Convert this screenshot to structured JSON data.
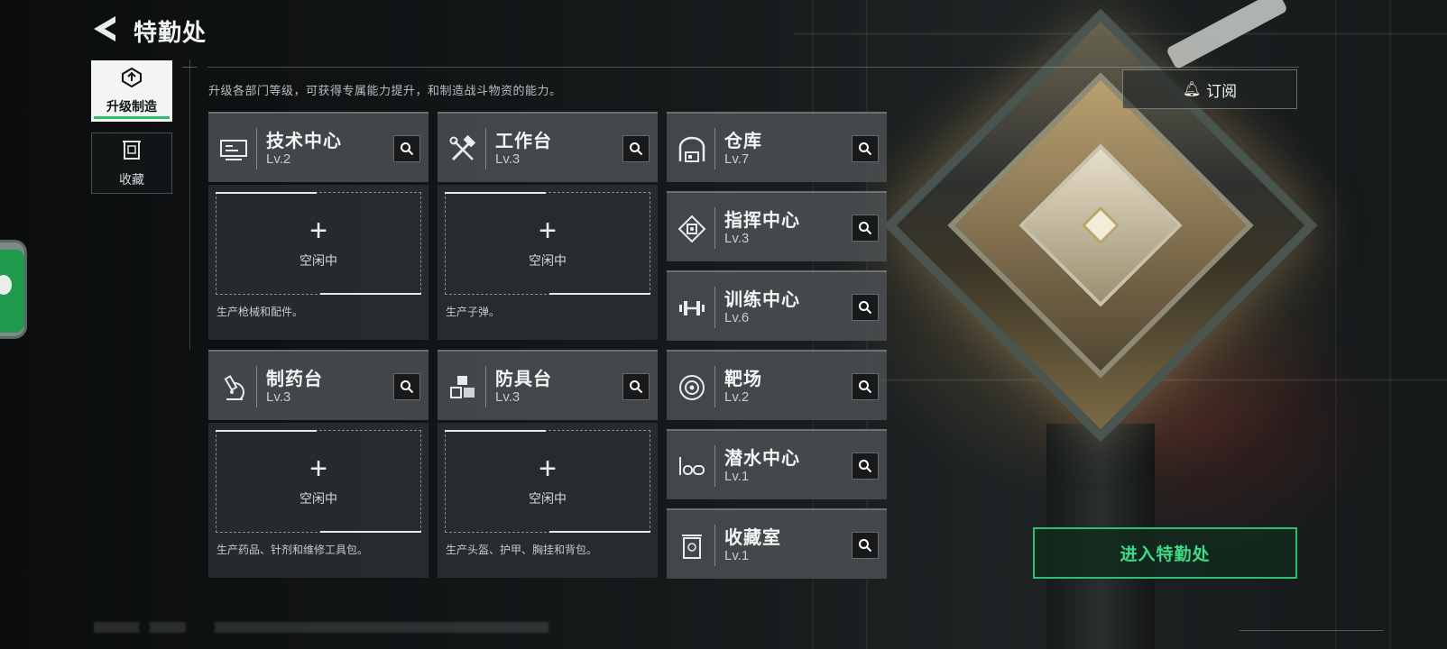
{
  "header": {
    "title": "特勤处"
  },
  "side_tabs": [
    {
      "label": "升级制造",
      "icon": "upgrade-icon",
      "active": true
    },
    {
      "label": "收藏",
      "icon": "collection-icon",
      "active": false
    }
  ],
  "description": "升级各部门等级，可获得专属能力提升，和制造战斗物资的能力。",
  "subscribe": {
    "label": "订阅",
    "icon": "bell-icon"
  },
  "departments": {
    "tech_center": {
      "name": "技术中心",
      "level": "Lv.2",
      "icon": "monitor-icon"
    },
    "workbench": {
      "name": "工作台",
      "level": "Lv.3",
      "icon": "tools-icon"
    },
    "pharmacy": {
      "name": "制药台",
      "level": "Lv.3",
      "icon": "microscope-icon"
    },
    "armor_bench": {
      "name": "防具台",
      "level": "Lv.3",
      "icon": "blocks-icon"
    },
    "warehouse": {
      "name": "仓库",
      "level": "Lv.7",
      "icon": "warehouse-icon"
    },
    "command_center": {
      "name": "指挥中心",
      "level": "Lv.3",
      "icon": "chip-icon"
    },
    "training_center": {
      "name": "训练中心",
      "level": "Lv.6",
      "icon": "dumbbell-icon"
    },
    "shooting_range": {
      "name": "靶场",
      "level": "Lv.2",
      "icon": "target-icon"
    },
    "diving_center": {
      "name": "潜水中心",
      "level": "Lv.1",
      "icon": "goggles-icon"
    },
    "collection_room": {
      "name": "收藏室",
      "level": "Lv.1",
      "icon": "display-case-icon"
    }
  },
  "slots": {
    "tech_center": {
      "status": "空闲中",
      "desc": "生产枪械和配件。"
    },
    "workbench": {
      "status": "空闲中",
      "desc": "生产子弹。"
    },
    "pharmacy": {
      "status": "空闲中",
      "desc": "生产药品、针剂和维修工具包。"
    },
    "armor_bench": {
      "status": "空闲中",
      "desc": "生产头盔、护甲、胸挂和背包。"
    }
  },
  "enter_button": {
    "label": "进入特勤处"
  },
  "colors": {
    "accent_green": "#2fbf71",
    "enter_text": "#3ddc84",
    "card_bg": "#4e5254",
    "panel_bg": "#2c2f31"
  }
}
